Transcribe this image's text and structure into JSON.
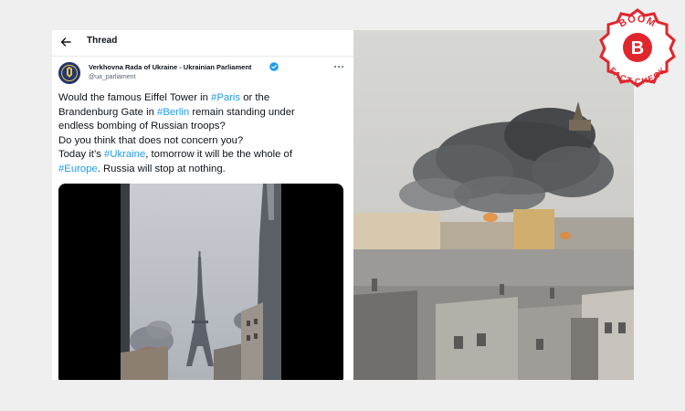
{
  "thread": {
    "title": "Thread"
  },
  "author": {
    "name": "Verkhovna Rada of Ukraine - Ukrainian Parliament",
    "handle": "@ua_parliament"
  },
  "tweet": {
    "line1_a": "Would the famous Eiffel Tower in ",
    "tag_paris": "#Paris",
    "line1_b": " or the",
    "line2_a": "Brandenburg Gate in ",
    "tag_berlin": "#Berlin",
    "line2_b": " remain standing under",
    "line3": "endless bombing of Russian troops?",
    "line4": "Do you think that does not concern you?",
    "line5_a": "Today it’s ",
    "tag_ukraine": "#Ukraine",
    "line5_b": ", tomorrow it will be the whole of",
    "tag_europe": "#Europe",
    "line6_b": ". Russia will stop at nothing."
  },
  "badge": {
    "top_text": "BOOM",
    "letter": "B",
    "bottom_text": "FACT CHECK"
  },
  "colors": {
    "accent": "#1d9bf0",
    "badge_red": "#e0262d"
  },
  "icons": {
    "back": "arrow-left-icon",
    "verified": "verified-badge-icon",
    "more": "more-dots-icon"
  }
}
